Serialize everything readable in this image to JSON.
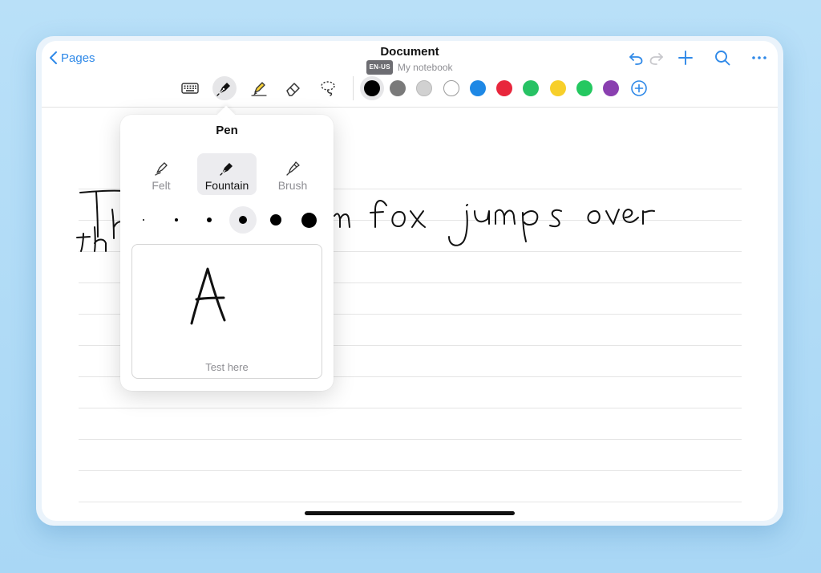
{
  "nav": {
    "back_label": "Pages"
  },
  "document": {
    "title": "Document",
    "language_badge": "EN-US",
    "notebook": "My notebook"
  },
  "actions": [
    "undo-icon",
    "redo-icon",
    "add-icon",
    "search-icon",
    "more-icon"
  ],
  "tools": [
    {
      "name": "keyboard",
      "icon": "keyboard-icon",
      "active": false
    },
    {
      "name": "pen",
      "icon": "fountain-pen-icon",
      "active": true
    },
    {
      "name": "highlighter",
      "icon": "highlighter-icon",
      "active": false
    },
    {
      "name": "eraser",
      "icon": "eraser-icon",
      "active": false
    },
    {
      "name": "lasso",
      "icon": "lasso-icon",
      "active": false
    }
  ],
  "colors": {
    "selected": "#000000",
    "palette": [
      "#000000",
      "#7a7a7a",
      "#d1d1d1",
      "#ffffff",
      "#1e88e5",
      "#e8263c",
      "#27c264",
      "#f7cf2a",
      "#24c860",
      "#8a3fb0"
    ]
  },
  "pen_popover": {
    "title": "Pen",
    "pen_types": [
      {
        "label": "Felt",
        "icon": "felt-pen-icon",
        "selected": false
      },
      {
        "label": "Fountain",
        "icon": "fountain-pen-icon",
        "selected": true
      },
      {
        "label": "Brush",
        "icon": "brush-pen-icon",
        "selected": false
      }
    ],
    "sizes_count": 6,
    "selected_size_index": 3,
    "test_label": "Test here"
  }
}
